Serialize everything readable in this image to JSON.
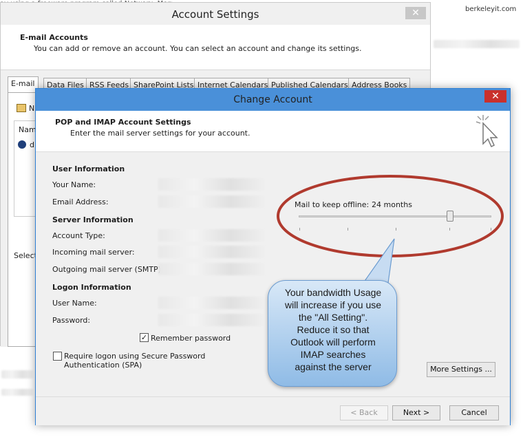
{
  "background": {
    "top_text": "ay using a freeware  program called Networx.  Moments ago a spike in",
    "right_text": "berkeleyit.com"
  },
  "account_settings": {
    "title": "Account Settings",
    "close_glyph": "✕",
    "header_title": "E-mail Accounts",
    "header_desc": "You can add or remove an account. You can select an account and change its settings.",
    "tabs": [
      "E-mail",
      "Data Files",
      "RSS Feeds",
      "SharePoint Lists",
      "Internet Calendars",
      "Published Calendars",
      "Address Books"
    ],
    "new_label": "N",
    "name_col": "Nam",
    "account_entry": "d",
    "select_text": "Select"
  },
  "change_account": {
    "title": "Change Account",
    "close_glyph": "✕",
    "header_title": "POP and IMAP Account Settings",
    "header_desc": "Enter the mail server settings for your account.",
    "sections": {
      "user_info": "User Information",
      "server_info": "Server Information",
      "logon_info": "Logon Information"
    },
    "labels": {
      "your_name": "Your Name:",
      "email_address": "Email Address:",
      "account_type": "Account Type:",
      "incoming_server": "Incoming mail server:",
      "outgoing_server": "Outgoing mail server (SMTP):",
      "user_name": "User Name:",
      "password": "Password:"
    },
    "remember_password": {
      "label": "Remember password",
      "checked": true
    },
    "spa": {
      "label": "Require logon using Secure Password Authentication (SPA)",
      "checked": false
    },
    "offline": {
      "label": "Mail to keep offline:",
      "value": "24 months"
    },
    "buttons": {
      "more_settings": "More Settings ...",
      "back": "< Back",
      "next": "Next >",
      "cancel": "Cancel"
    }
  },
  "callout": {
    "lines": [
      "Your bandwidth Usage",
      "will increase if you use",
      "the \"All Setting\".",
      "Reduce it so that",
      "Outlook will perform",
      "IMAP searches",
      "against the server"
    ]
  },
  "colors": {
    "dialog_accent": "#4a90d9",
    "close_red": "#c9302c",
    "annotation_ellipse": "#b03a2e"
  }
}
